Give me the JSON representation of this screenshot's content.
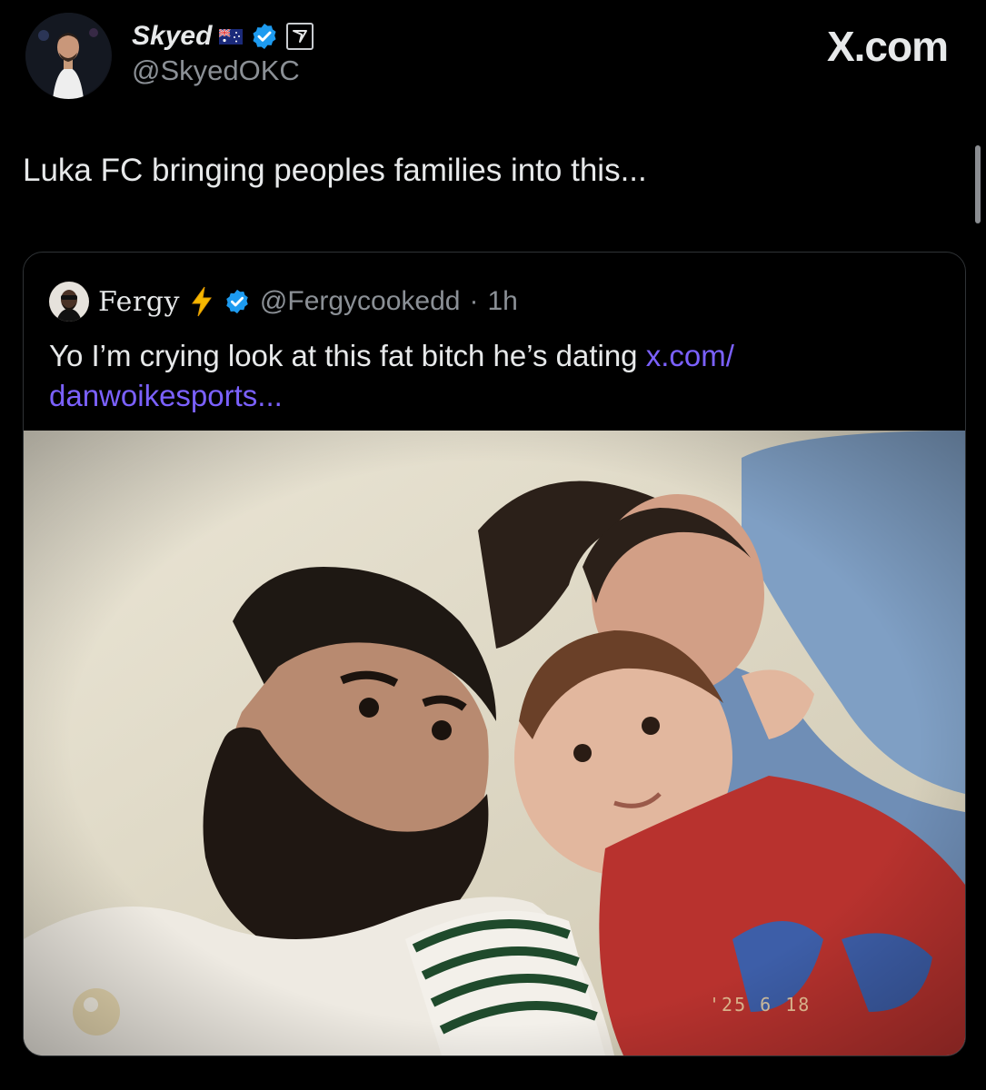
{
  "author": {
    "display_name": "Skyed",
    "handle": "@SkyedOKC",
    "flag_icon": "australia-flag-icon",
    "verified_icon": "verified-badge-icon",
    "affiliate_icon": "affiliate-badge-icon"
  },
  "brand": {
    "watermark": "X.com"
  },
  "tweet": {
    "text": "Luka FC bringing peoples families into this..."
  },
  "quoted_tweet": {
    "display_name": "Fergy",
    "name_emoji_icon": "lightning-bolt-icon",
    "verified_icon": "verified-badge-icon",
    "handle": "@Fergycookedd",
    "separator": "·",
    "time": "1h",
    "text": "Yo I’m crying look at this fat bitch he’s dating ",
    "link_text": "x.com/\ndanwoikesports...",
    "media": {
      "type": "photo",
      "date_stamp": "'25 6 18"
    }
  },
  "colors": {
    "background": "#000000",
    "text_primary": "#e7e9ea",
    "text_secondary": "#8b9096",
    "link": "#7b61ff",
    "verified": "#1d9bf0",
    "border": "#2f3336"
  }
}
